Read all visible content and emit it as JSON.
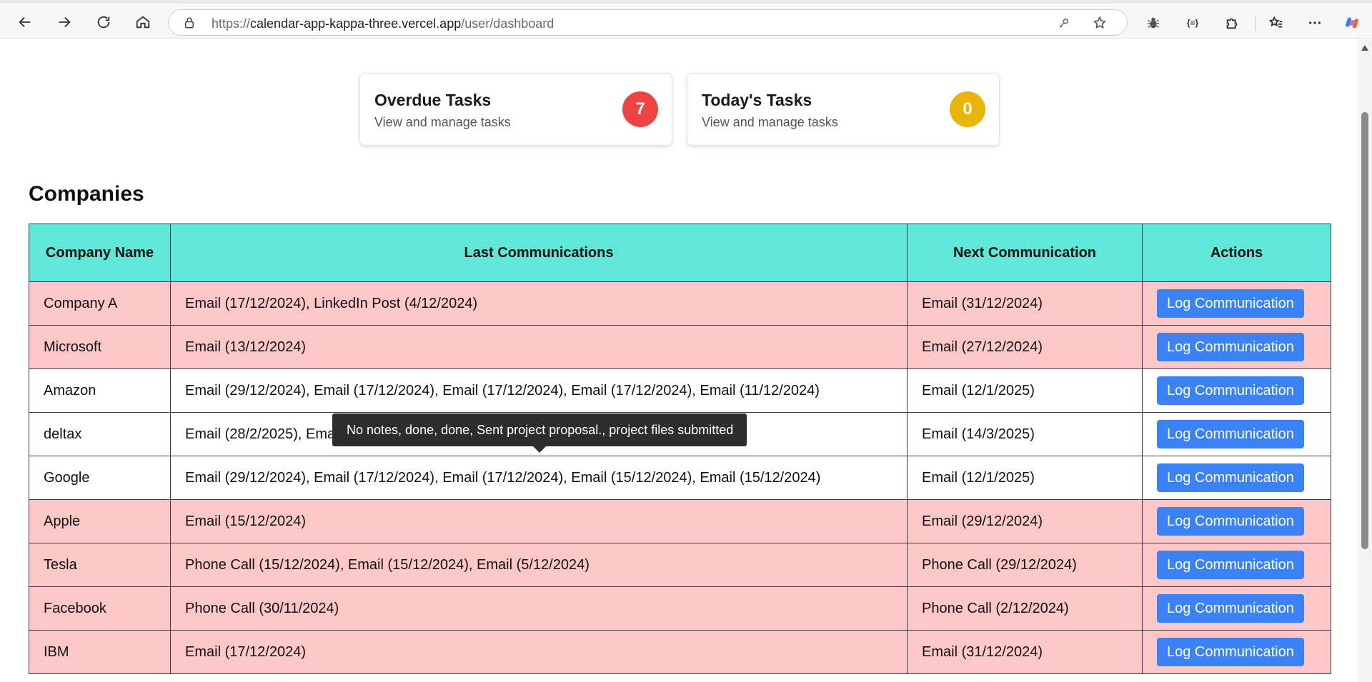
{
  "browser": {
    "url_scheme": "https://",
    "url_host": "calendar-app-kappa-three.vercel.app",
    "url_path": "/user/dashboard",
    "ext_label": "{≡}"
  },
  "cards": {
    "overdue": {
      "title": "Overdue Tasks",
      "subtitle": "View and manage tasks",
      "count": "7",
      "color": "#ef4444"
    },
    "today": {
      "title": "Today's Tasks",
      "subtitle": "View and manage tasks",
      "count": "0",
      "color": "#eab308"
    }
  },
  "companies": {
    "title": "Companies",
    "columns": [
      "Company Name",
      "Last Communications",
      "Next Communication",
      "Actions"
    ],
    "action_label": "Log Communication",
    "rows": [
      {
        "name": "Company A",
        "last": "Email (17/12/2024), LinkedIn Post (4/12/2024)",
        "next": "Email (31/12/2024)",
        "status": "overdue"
      },
      {
        "name": "Microsoft",
        "last": "Email (13/12/2024)",
        "next": "Email (27/12/2024)",
        "status": "overdue"
      },
      {
        "name": "Amazon",
        "last": "Email (29/12/2024), Email (17/12/2024), Email (17/12/2024), Email (17/12/2024), Email (11/12/2024)",
        "next": "Email (12/1/2025)",
        "status": "normal"
      },
      {
        "name": "deltax",
        "last": "Email (28/2/2025), Email",
        "next": "Email (14/3/2025)",
        "status": "normal"
      },
      {
        "name": "Google",
        "last": "Email (29/12/2024), Email (17/12/2024), Email (17/12/2024), Email (15/12/2024), Email (15/12/2024)",
        "next": "Email (12/1/2025)",
        "status": "normal"
      },
      {
        "name": "Apple",
        "last": "Email (15/12/2024)",
        "next": "Email (29/12/2024)",
        "status": "overdue"
      },
      {
        "name": "Tesla",
        "last": "Phone Call (15/12/2024), Email (15/12/2024), Email (5/12/2024)",
        "next": "Phone Call (29/12/2024)",
        "status": "overdue"
      },
      {
        "name": "Facebook",
        "last": "Phone Call (30/11/2024)",
        "next": "Phone Call (2/12/2024)",
        "status": "overdue"
      },
      {
        "name": "IBM",
        "last": "Email (17/12/2024)",
        "next": "Email (31/12/2024)",
        "status": "overdue"
      }
    ]
  },
  "tooltip": {
    "text": "No notes, done, done, Sent project proposal., project files submitted"
  }
}
